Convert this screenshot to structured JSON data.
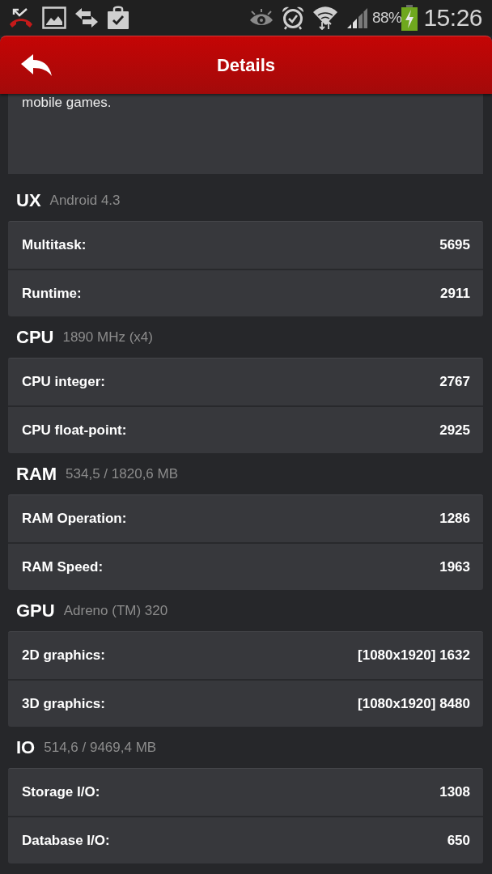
{
  "status_bar": {
    "battery_percent": "88%",
    "time": "15:26"
  },
  "header": {
    "title": "Details"
  },
  "description": {
    "text": "mobile games."
  },
  "sections": [
    {
      "title": "UX",
      "subtitle": "Android 4.3",
      "rows": [
        {
          "label": "Multitask:",
          "value": "5695"
        },
        {
          "label": "Runtime:",
          "value": "2911"
        }
      ]
    },
    {
      "title": "CPU",
      "subtitle": "1890 MHz (x4)",
      "rows": [
        {
          "label": "CPU integer:",
          "value": "2767"
        },
        {
          "label": "CPU float-point:",
          "value": "2925"
        }
      ]
    },
    {
      "title": "RAM",
      "subtitle": "534,5 / 1820,6 MB",
      "rows": [
        {
          "label": "RAM Operation:",
          "value": "1286"
        },
        {
          "label": "RAM Speed:",
          "value": "1963"
        }
      ]
    },
    {
      "title": "GPU",
      "subtitle": "Adreno (TM) 320",
      "rows": [
        {
          "label": "2D graphics:",
          "value": "[1080x1920] 1632"
        },
        {
          "label": "3D graphics:",
          "value": "[1080x1920] 8480"
        }
      ]
    },
    {
      "title": "IO",
      "subtitle": "514,6 / 9469,4 MB",
      "rows": [
        {
          "label": "Storage I/O:",
          "value": "1308"
        },
        {
          "label": "Database I/O:",
          "value": "650"
        }
      ]
    }
  ]
}
